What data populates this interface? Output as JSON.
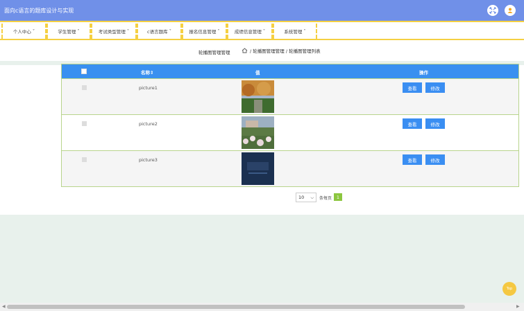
{
  "header": {
    "title": "面向c语言的题库设计与实现",
    "fullscreen_icon": "expand-icon",
    "user_icon": "user-icon"
  },
  "nav": {
    "items": [
      {
        "label": "个人中心"
      },
      {
        "label": "学生管理"
      },
      {
        "label": "考试类型管理"
      },
      {
        "label": "c语言题库"
      },
      {
        "label": "报名信息管理"
      },
      {
        "label": "成绩信息管理"
      },
      {
        "label": "系统管理"
      }
    ]
  },
  "breadcrumb": {
    "page_title": "轮播图管理管理",
    "home_icon": "home-icon",
    "path": "/ 轮播图管理管理 / 轮播图管理列表"
  },
  "table": {
    "columns": [
      "名称",
      "值",
      "操作"
    ],
    "rows": [
      {
        "name": "picture1",
        "thumb_colors": [
          "#c98b3a",
          "#3f6b2f",
          "#a7b5c9"
        ],
        "view_label": "查看",
        "edit_label": "修改"
      },
      {
        "name": "picture2",
        "thumb_colors": [
          "#5b7a44",
          "#e8d8dc",
          "#9db0c2"
        ],
        "view_label": "查看",
        "edit_label": "修改"
      },
      {
        "name": "picture3",
        "thumb_colors": [
          "#1b3050",
          "#2a4268",
          "#1a2b45"
        ],
        "view_label": "查看",
        "edit_label": "修改"
      }
    ]
  },
  "pagination": {
    "page_size": "10",
    "per_page_label": "条每页",
    "current_page": "1"
  },
  "top_button": {
    "label": "Top"
  },
  "colors": {
    "header_bg": "#7090e8",
    "nav_border": "#f5d042",
    "table_header": "#3990f0",
    "button": "#3a8ef2",
    "page_active": "#8cc63f"
  }
}
